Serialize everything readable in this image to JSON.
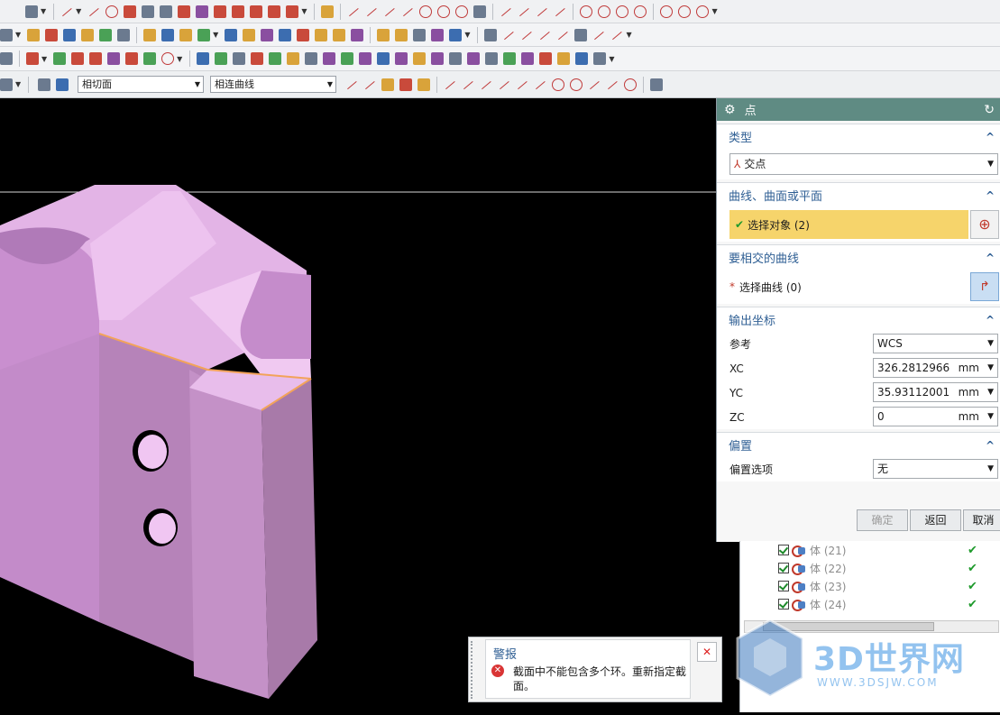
{
  "viewport": {
    "filter1": "相切面",
    "filter2": "相连曲线"
  },
  "dialog": {
    "title": "点",
    "type_section": "类型",
    "type_value": "交点",
    "curve_section": "曲线、曲面或平面",
    "select_object": "选择对象 (2)",
    "intersect_section": "要相交的曲线",
    "select_curve": "选择曲线 (0)",
    "output_section": "输出坐标",
    "ref_label": "参考",
    "ref_value": "WCS",
    "xc_label": "XC",
    "xc_value": "326.2812966",
    "yc_label": "YC",
    "yc_value": "35.93112001",
    "zc_label": "ZC",
    "zc_value": "0",
    "unit": "mm",
    "offset_section": "偏置",
    "offset_label": "偏置选项",
    "offset_value": "无",
    "ok": "确定",
    "back": "返回",
    "cancel": "取消"
  },
  "tree": {
    "rows": [
      {
        "label": "体 (21)"
      },
      {
        "label": "体 (22)"
      },
      {
        "label": "体 (23)"
      },
      {
        "label": "体 (24)"
      }
    ]
  },
  "warning": {
    "title": "警报",
    "message": "截面中不能包含多个环。重新指定截面。"
  },
  "watermark": {
    "logo": "3D世界网",
    "url": "WWW.3DSJW.COM"
  },
  "colors": {
    "titlebar": "#5f8b83",
    "highlight": "#f6d46b",
    "section_header": "#2f5f94",
    "model": "#e3b4e6"
  }
}
